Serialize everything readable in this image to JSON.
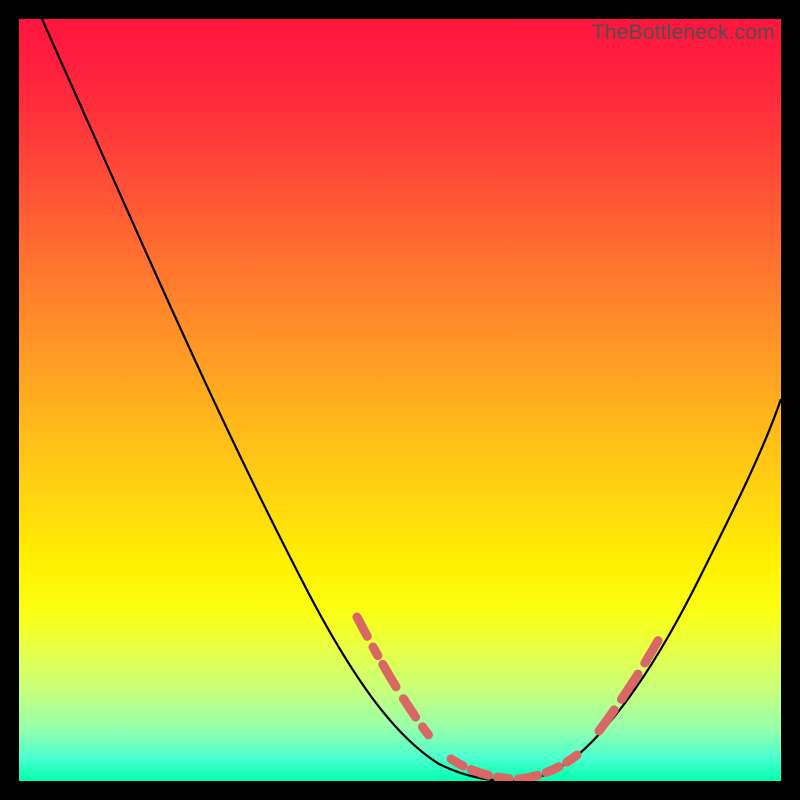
{
  "watermark": "TheBottleneck.com",
  "chart_data": {
    "type": "line",
    "title": "",
    "xlabel": "",
    "ylabel": "",
    "xlim": [
      0,
      100
    ],
    "ylim": [
      0,
      100
    ],
    "series": [
      {
        "name": "bottleneck-curve",
        "color": "#000000",
        "x": [
          3,
          8,
          14,
          20,
          26,
          32,
          38,
          44,
          48,
          52,
          55,
          58,
          61,
          63,
          66,
          69,
          73,
          78,
          84,
          90,
          96,
          100
        ],
        "y": [
          100,
          90,
          79,
          68,
          56,
          45,
          33,
          21,
          13,
          6,
          3,
          1,
          0,
          0,
          1,
          3,
          8,
          15,
          24,
          34,
          44,
          51
        ]
      },
      {
        "name": "highlight-segments",
        "color": "#d96765",
        "style": "dashed-thick",
        "segments": [
          {
            "x": [
              44,
              48,
              52,
              55
            ],
            "y": [
              21,
              13,
              6,
              3
            ]
          },
          {
            "x": [
              58,
              61,
              63,
              66,
              69
            ],
            "y": [
              1,
              0,
              0,
              1,
              3
            ]
          },
          {
            "x": [
              73,
              78
            ],
            "y": [
              8,
              15
            ]
          }
        ]
      }
    ]
  },
  "colors": {
    "black_curve": "#000000",
    "highlight": "#d96765",
    "frame": "#000000"
  }
}
